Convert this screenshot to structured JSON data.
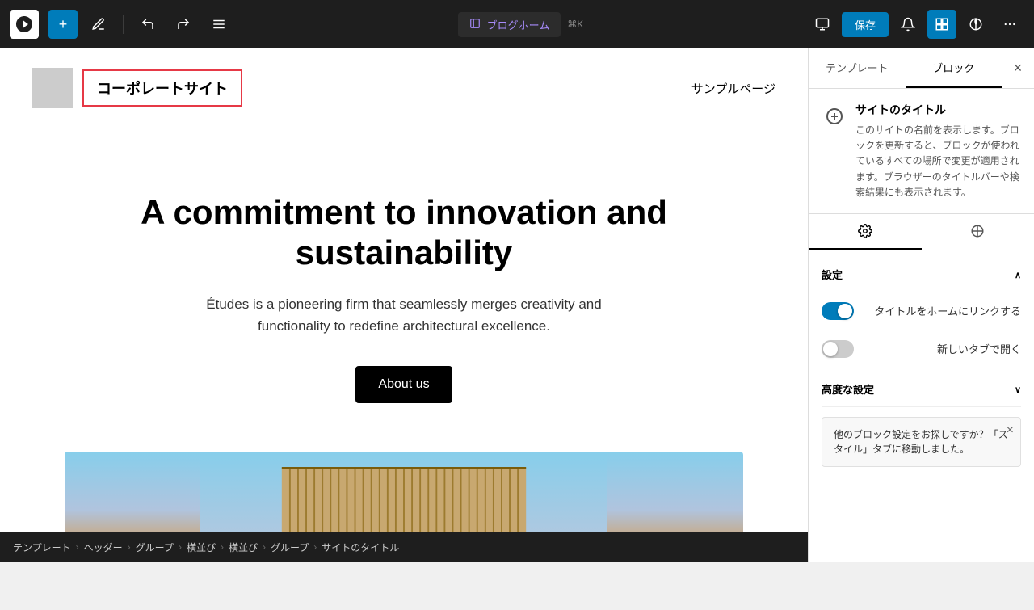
{
  "toolbar": {
    "wp_logo_alt": "WordPress",
    "add_label": "+",
    "design_label": "✏",
    "undo_label": "↩",
    "redo_label": "↪",
    "list_label": "≡",
    "url_icon": "⬤",
    "url_text": "ブログホーム",
    "url_shortcut": "⌘K",
    "save_label": "保存",
    "desktop_icon": "🖥",
    "view_icon": "⧉",
    "theme_icon": "◑",
    "more_icon": "⋯"
  },
  "canvas": {
    "site_title": "コーポレートサイト",
    "nav_link": "サンプルページ",
    "hero_title": "A commitment to innovation and sustainability",
    "hero_desc": "Études is a pioneering firm that seamlessly merges creativity and functionality to redefine architectural excellence.",
    "about_btn": "About us"
  },
  "panel": {
    "tab_template": "テンプレート",
    "tab_block": "ブロック",
    "block_title": "サイトのタイトル",
    "block_desc": "このサイトの名前を表示します。ブロックを更新すると、ブロックが使われているすべての場所で変更が適用されます。ブラウザーのタイトルバーや検索結果にも表示されます。",
    "settings_tab_label": "設定",
    "style_tab_label": "スタイル",
    "settings_section_label": "設定",
    "link_home_label": "タイトルをホームにリンクする",
    "new_tab_label": "新しいタブで開く",
    "advanced_label": "高度な設定",
    "tooltip_text": "他のブロック設定をお探しですか？「スタイル」タブに移動しました。",
    "toggle_home_state": "on",
    "toggle_newtab_state": "off"
  },
  "breadcrumb": {
    "items": [
      "テンプレート",
      "ヘッダー",
      "グループ",
      "横並び",
      "横並び",
      "グループ",
      "サイトのタイトル"
    ]
  }
}
